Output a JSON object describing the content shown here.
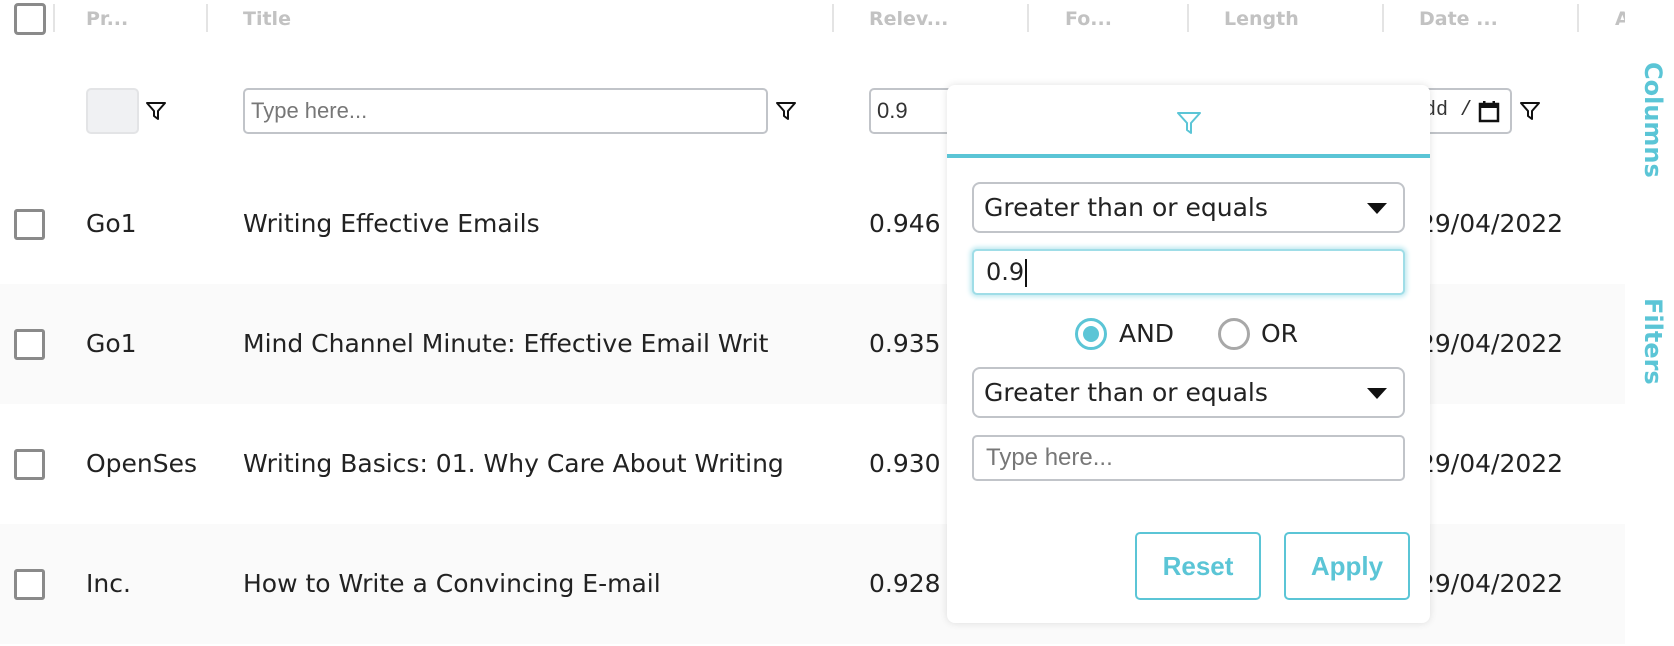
{
  "header": {
    "columns": [
      {
        "label": "Pr..."
      },
      {
        "label": "Title"
      },
      {
        "label": "Relev..."
      },
      {
        "label": "Fo..."
      },
      {
        "label": "Length"
      },
      {
        "label": "Date ..."
      },
      {
        "label": "A"
      }
    ]
  },
  "filters": {
    "title_placeholder": "Type here...",
    "relevance_value": "0.9",
    "date_value": "dd /"
  },
  "rows": [
    {
      "provider": "Go1",
      "title": "Writing Effective Emails",
      "relevance": "0.946",
      "date": "29/04/2022"
    },
    {
      "provider": "Go1",
      "title": "Mind Channel Minute: Effective Email Writ",
      "relevance": "0.935",
      "date": "29/04/2022"
    },
    {
      "provider": "OpenSes",
      "title": "Writing Basics: 01. Why Care About Writing",
      "relevance": "0.930",
      "date": "29/04/2022"
    },
    {
      "provider": "Inc.",
      "title": "How to Write a Convincing E-mail",
      "relevance": "0.928",
      "date": "29/04/2022"
    }
  ],
  "popup": {
    "condition1": "Greater than or equals",
    "value1": "0.9",
    "join_and": "AND",
    "join_or": "OR",
    "join_selected": "AND",
    "condition2": "Greater than or equals",
    "value2_placeholder": "Type here...",
    "reset_label": "Reset",
    "apply_label": "Apply"
  },
  "side_panel": {
    "columns_label": "Columns",
    "filters_label": "Filters"
  },
  "colors": {
    "accent": "#5bc5d6",
    "header_text": "#c2c2c2"
  }
}
